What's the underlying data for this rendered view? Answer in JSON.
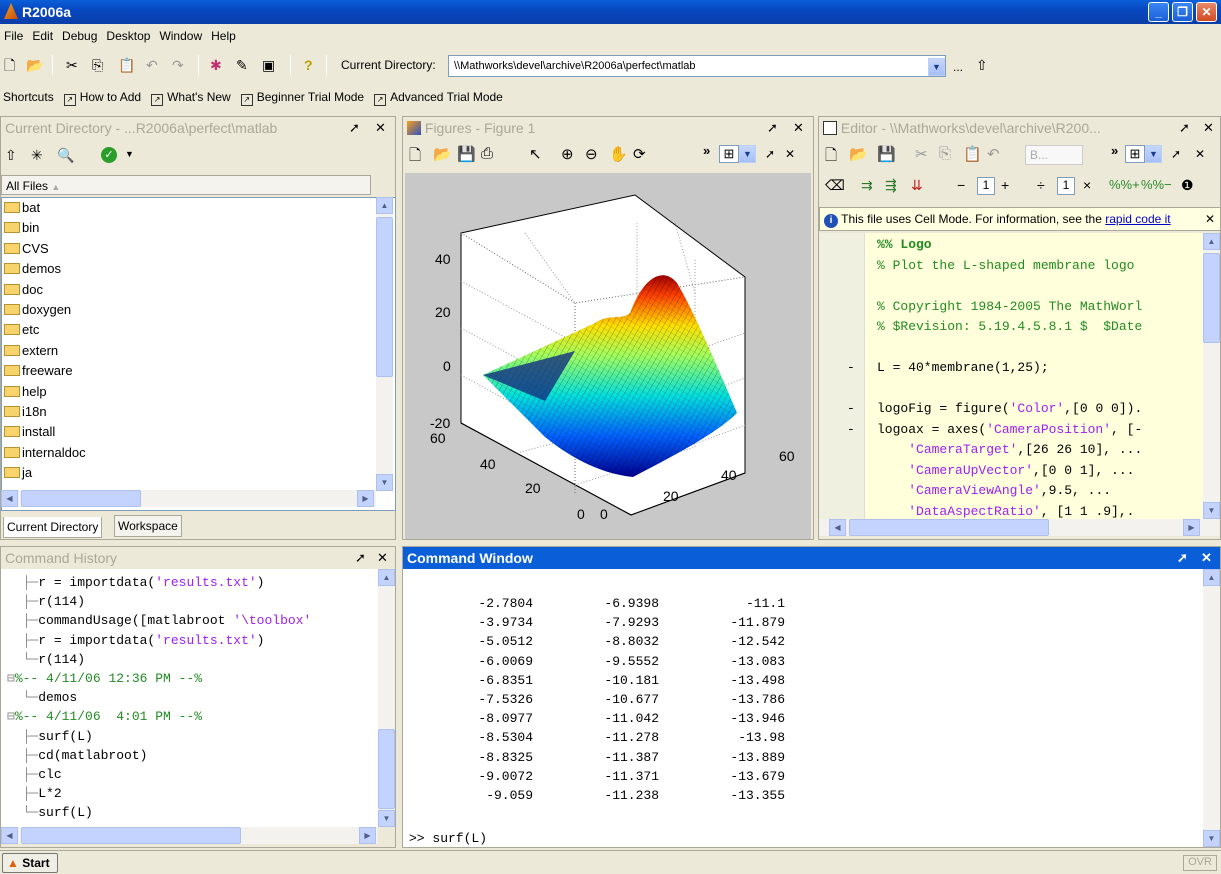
{
  "window": {
    "title": "R2006a",
    "colors": {
      "titlebar": "#0a5fd8",
      "bg": "#ece9d8"
    }
  },
  "menu": [
    "File",
    "Edit",
    "Debug",
    "Desktop",
    "Window",
    "Help"
  ],
  "toolbar": {
    "current_dir_label": "Current Directory:",
    "current_dir_value": "\\\\Mathworks\\devel\\archive\\R2006a\\perfect\\matlab",
    "browse": "..."
  },
  "shortcuts": {
    "label": "Shortcuts",
    "items": [
      "How to Add",
      "What's New",
      "Beginner Trial Mode",
      "Advanced Trial Mode"
    ]
  },
  "current_directory": {
    "title": "Current Directory - ...R2006a\\perfect\\matlab",
    "column_header": "All Files",
    "items": [
      "bat",
      "bin",
      "CVS",
      "demos",
      "doc",
      "doxygen",
      "etc",
      "extern",
      "freeware",
      "help",
      "i18n",
      "install",
      "internaldoc",
      "ja"
    ],
    "tabs": [
      "Current Directory",
      "Workspace"
    ]
  },
  "figures": {
    "title": "Figures - Figure 1",
    "plot": {
      "z_ticks": [
        "40",
        "20",
        "0",
        "-20"
      ],
      "x_ticks": [
        "60",
        "40",
        "20",
        "0"
      ],
      "y_ticks": [
        "0",
        "20",
        "40",
        "60"
      ]
    }
  },
  "editor": {
    "title": "Editor - \\\\Mathworks\\devel\\archive\\R200...",
    "step_value_1": "1",
    "step_value_2": "1",
    "cell_bar_value": "B...",
    "info": "This file uses Cell Mode. For information, see the",
    "info_link": "rapid code it",
    "lines": [
      {
        "dash": "",
        "cls": "green",
        "text": "%% Logo",
        "bold": true
      },
      {
        "dash": "",
        "cls": "green",
        "text": "% Plot the L-shaped membrane logo"
      },
      {
        "dash": "",
        "cls": "",
        "text": ""
      },
      {
        "dash": "",
        "cls": "green",
        "text": "% Copyright 1984-2005 The MathWorl"
      },
      {
        "dash": "",
        "cls": "green",
        "text": "% $Revision: 5.19.4.5.8.1 $  $Date"
      },
      {
        "dash": "",
        "cls": "",
        "text": ""
      },
      {
        "dash": "-",
        "cls": "",
        "text": "L = 40*membrane(1,25);"
      },
      {
        "dash": "",
        "cls": "",
        "text": ""
      },
      {
        "dash": "-",
        "cls": "",
        "text": "logoFig = figure('Color',[0 0 0])."
      },
      {
        "dash": "-",
        "cls": "",
        "text": "logoax = axes('CameraPosition', [-"
      },
      {
        "dash": "",
        "cls": "",
        "text": "    'CameraTarget',[26 26 10], ..."
      },
      {
        "dash": "",
        "cls": "",
        "text": "    'CameraUpVector',[0 0 1], ..."
      },
      {
        "dash": "",
        "cls": "",
        "text": "    'CameraViewAngle',9.5, ..."
      },
      {
        "dash": "",
        "cls": "",
        "text": "    'DataAspectRatio', [1 1 .9],."
      }
    ]
  },
  "history": {
    "title": "Command History",
    "entries": [
      {
        "prefix": "  ├─",
        "text": "r = importdata('results.txt')",
        "kind": "cmd"
      },
      {
        "prefix": "  ├─",
        "text": "r(114)",
        "kind": "cmd"
      },
      {
        "prefix": "  ├─",
        "text": "commandUsage([matlabroot '\\toolbox'",
        "kind": "cmd"
      },
      {
        "prefix": "  ├─",
        "text": "r = importdata('results.txt')",
        "kind": "cmd"
      },
      {
        "prefix": "  └─",
        "text": "r(114)",
        "kind": "cmd"
      },
      {
        "prefix": "⊟",
        "text": "%-- 4/11/06 12:36 PM --%",
        "kind": "sess"
      },
      {
        "prefix": "  └─",
        "text": "demos",
        "kind": "cmd"
      },
      {
        "prefix": "⊟",
        "text": "%-- 4/11/06  4:01 PM --%",
        "kind": "sess"
      },
      {
        "prefix": "  ├─",
        "text": "surf(L)",
        "kind": "cmd"
      },
      {
        "prefix": "  ├─",
        "text": "cd(matlabroot)",
        "kind": "cmd"
      },
      {
        "prefix": "  ├─",
        "text": "clc",
        "kind": "cmd"
      },
      {
        "prefix": "  ├─",
        "text": "L*2",
        "kind": "cmd"
      },
      {
        "prefix": "  └─",
        "text": "surf(L)",
        "kind": "cmd"
      }
    ]
  },
  "command_window": {
    "title": "Command Window",
    "rows": [
      [
        "-2.7804",
        "-6.9398",
        "-11.1"
      ],
      [
        "-3.9734",
        "-7.9293",
        "-11.879"
      ],
      [
        "-5.0512",
        "-8.8032",
        "-12.542"
      ],
      [
        "-6.0069",
        "-9.5552",
        "-13.083"
      ],
      [
        "-6.8351",
        "-10.181",
        "-13.498"
      ],
      [
        "-7.5326",
        "-10.677",
        "-13.786"
      ],
      [
        "-8.0977",
        "-11.042",
        "-13.946"
      ],
      [
        "-8.5304",
        "-11.278",
        "-13.98"
      ],
      [
        "-8.8325",
        "-11.387",
        "-13.889"
      ],
      [
        "-9.0072",
        "-11.371",
        "-13.679"
      ],
      [
        "-9.059",
        "-11.238",
        "-13.355"
      ]
    ],
    "last_cmd": ">> surf(L)",
    "prompt": ">> "
  },
  "status": {
    "start": "Start",
    "ovr": "OVR"
  }
}
